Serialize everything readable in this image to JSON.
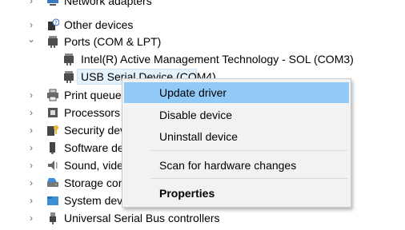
{
  "tree": {
    "items": [
      {
        "label": "Network adapters",
        "icon": "network-icon",
        "chevron": "›"
      },
      {
        "label": "Other devices",
        "icon": "unknown-device-icon",
        "chevron": "›"
      },
      {
        "label": "Ports (COM & LPT)",
        "icon": "port-icon",
        "chevron": "⌄"
      },
      {
        "label": "Intel(R) Active Management Technology - SOL (COM3)",
        "icon": "port-icon",
        "chevron": ""
      },
      {
        "label": "USB Serial Device (COM4)",
        "icon": "port-icon",
        "chevron": ""
      },
      {
        "label": "Print queues",
        "icon": "printer-icon",
        "chevron": "›"
      },
      {
        "label": "Processors",
        "icon": "processor-icon",
        "chevron": "›"
      },
      {
        "label": "Security devices",
        "icon": "security-icon",
        "chevron": "›"
      },
      {
        "label": "Software devices",
        "icon": "software-icon",
        "chevron": "›"
      },
      {
        "label": "Sound, video and game controllers",
        "icon": "speaker-icon",
        "chevron": "›"
      },
      {
        "label": "Storage controllers",
        "icon": "storage-icon",
        "chevron": "›"
      },
      {
        "label": "System devices",
        "icon": "folder-icon",
        "chevron": "›"
      },
      {
        "label": "Universal Serial Bus controllers",
        "icon": "usb-icon",
        "chevron": "›"
      }
    ]
  },
  "context_menu": {
    "items": [
      {
        "label": "Update driver"
      },
      {
        "label": "Disable device"
      },
      {
        "label": "Uninstall device"
      },
      {
        "label": "Scan for hardware changes"
      },
      {
        "label": "Properties"
      }
    ]
  },
  "colors": {
    "menu_hover": "#91c9f7",
    "selection": "#e5f1fb",
    "menu_bg": "#f2f2f2"
  }
}
